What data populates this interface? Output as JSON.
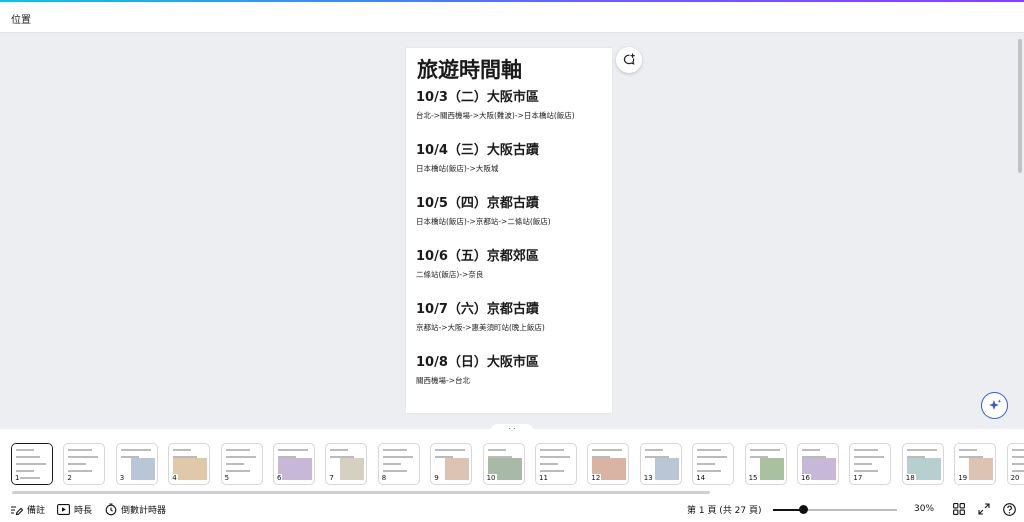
{
  "topbar": {
    "title": "位置"
  },
  "slide": {
    "title": "旅遊時間軸",
    "entries": [
      {
        "date": "10/3（二）大阪市區",
        "route": "台北->關西機場->大阪(難波)->日本橋站(飯店)"
      },
      {
        "date": "10/4（三）大阪古蹟",
        "route": "日本橋站(飯店)->大阪城"
      },
      {
        "date": "10/5（四）京都古蹟",
        "route": "日本橋站(飯店)->京都站->二條站(飯店)"
      },
      {
        "date": "10/6（五）京都郊區",
        "route": "二條站(飯店)->奈良"
      },
      {
        "date": "10/7（六）京都古蹟",
        "route": "京都站->大阪->惠美須町站(晚上飯店)"
      },
      {
        "date": "10/8（日）大阪市區",
        "route": "關西機場->台北"
      }
    ]
  },
  "thumbnails": [
    "1",
    "2",
    "3",
    "4",
    "5",
    "6",
    "7",
    "8",
    "9",
    "10",
    "11",
    "12",
    "13",
    "14",
    "15",
    "16",
    "17",
    "18",
    "19",
    "20"
  ],
  "bottombar": {
    "notes_label": "備註",
    "duration_label": "時長",
    "timer_label": "倒數計時器",
    "page_indicator": "第 1 頁 (共 27 頁)",
    "zoom": "30%",
    "zoom_level": 0.24
  },
  "icons": {
    "notes": "notes-icon",
    "duration": "play-icon",
    "timer": "timer-icon",
    "comment": "add-comment-icon",
    "magic": "magic-sparkle-icon",
    "grid": "grid-view-icon",
    "fullscreen": "fullscreen-icon",
    "help": "help-icon",
    "collapse": "chevron-down-icon"
  },
  "colors": {
    "accent": "#8b3dff",
    "magic_border": "#3b56d4"
  }
}
